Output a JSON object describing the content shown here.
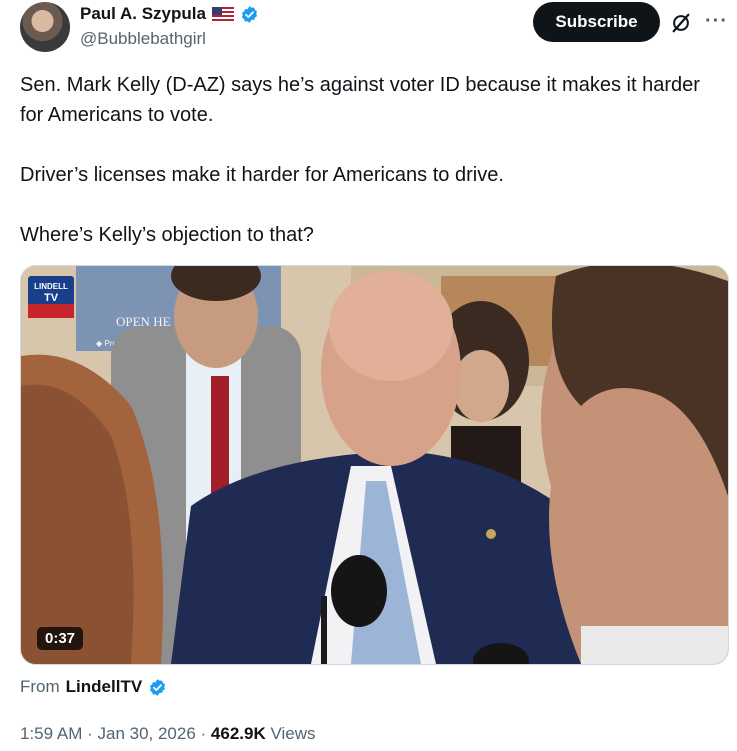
{
  "author": {
    "name": "Paul A. Szypula",
    "handle": "@Bubblebathgirl",
    "flag_icon": "us-flag-icon",
    "verified_icon": "verified-badge-icon"
  },
  "actions": {
    "subscribe_label": "Subscribe",
    "grok_icon": "grok-icon",
    "more_icon": "more-icon",
    "more_glyph": "···"
  },
  "tweet": {
    "paragraphs": [
      "Sen. Mark Kelly (D-AZ) says he’s against voter ID because it makes it harder for Americans to vote.",
      "Driver’s licenses make it harder for Americans to drive.",
      "Where’s Kelly’s objection to that?"
    ]
  },
  "media": {
    "type": "video",
    "duration": "0:37",
    "watermark": {
      "line1": "LINDELL",
      "line2": "TV"
    },
    "background_sign_text": {
      "line1": "OPEN HE",
      "line2": "◆ Prohibit"
    }
  },
  "from": {
    "label": "From",
    "source": "LindellTV",
    "verified_icon": "verified-badge-icon"
  },
  "meta": {
    "time": "1:59 AM",
    "separator": " · ",
    "date": "Jan 30, 2026",
    "views_count": "462.9K",
    "views_label": "Views"
  },
  "colors": {
    "verified_blue": "#1d9bf0",
    "text_primary": "#0f1419",
    "text_secondary": "#536471",
    "subscribe_bg": "#0f1419"
  }
}
